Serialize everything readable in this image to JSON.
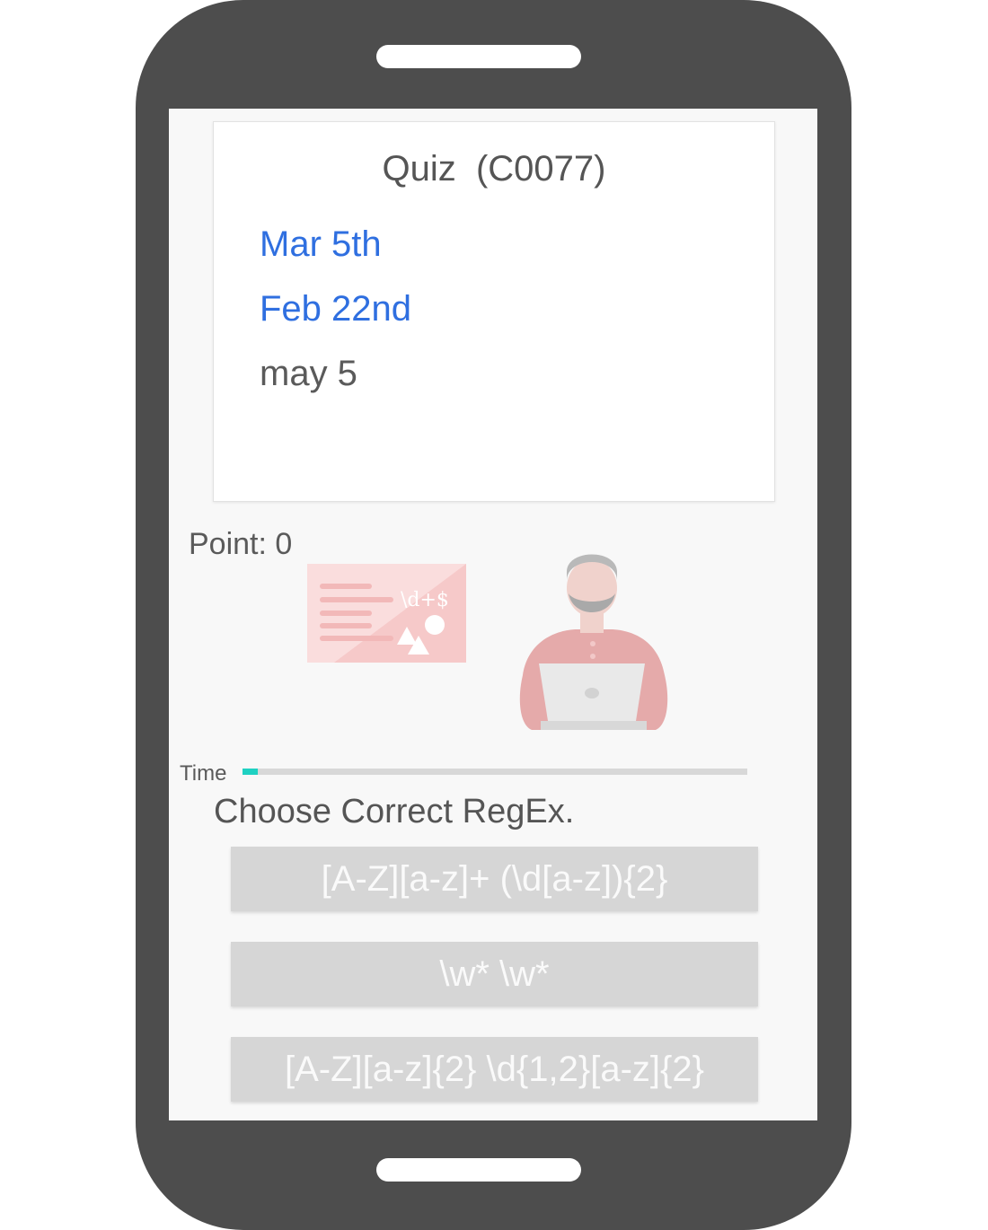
{
  "quiz": {
    "title": "Quiz  (C0077)",
    "lines": [
      "Mar 5th",
      "Feb 22nd",
      "may 5"
    ]
  },
  "score": {
    "label": "Point: 0"
  },
  "illustration": {
    "board_text": "\\d+$",
    "icons": [
      "regex-board-icon",
      "developer-laptop-icon"
    ]
  },
  "timer": {
    "label": "Time",
    "progress_fraction": 0.03,
    "color": "#1fd1c2"
  },
  "question": "Choose Correct RegEx.",
  "answers": [
    "[A-Z][a-z]+ (\\d[a-z]){2}",
    "\\w* \\w*",
    "[A-Z][a-z]{2} \\d{1,2}[a-z]{2}"
  ],
  "colors": {
    "phone_body": "#4d4d4d",
    "highlight_text": "#2f6fe0",
    "answer_button": "#d6d6d6"
  }
}
